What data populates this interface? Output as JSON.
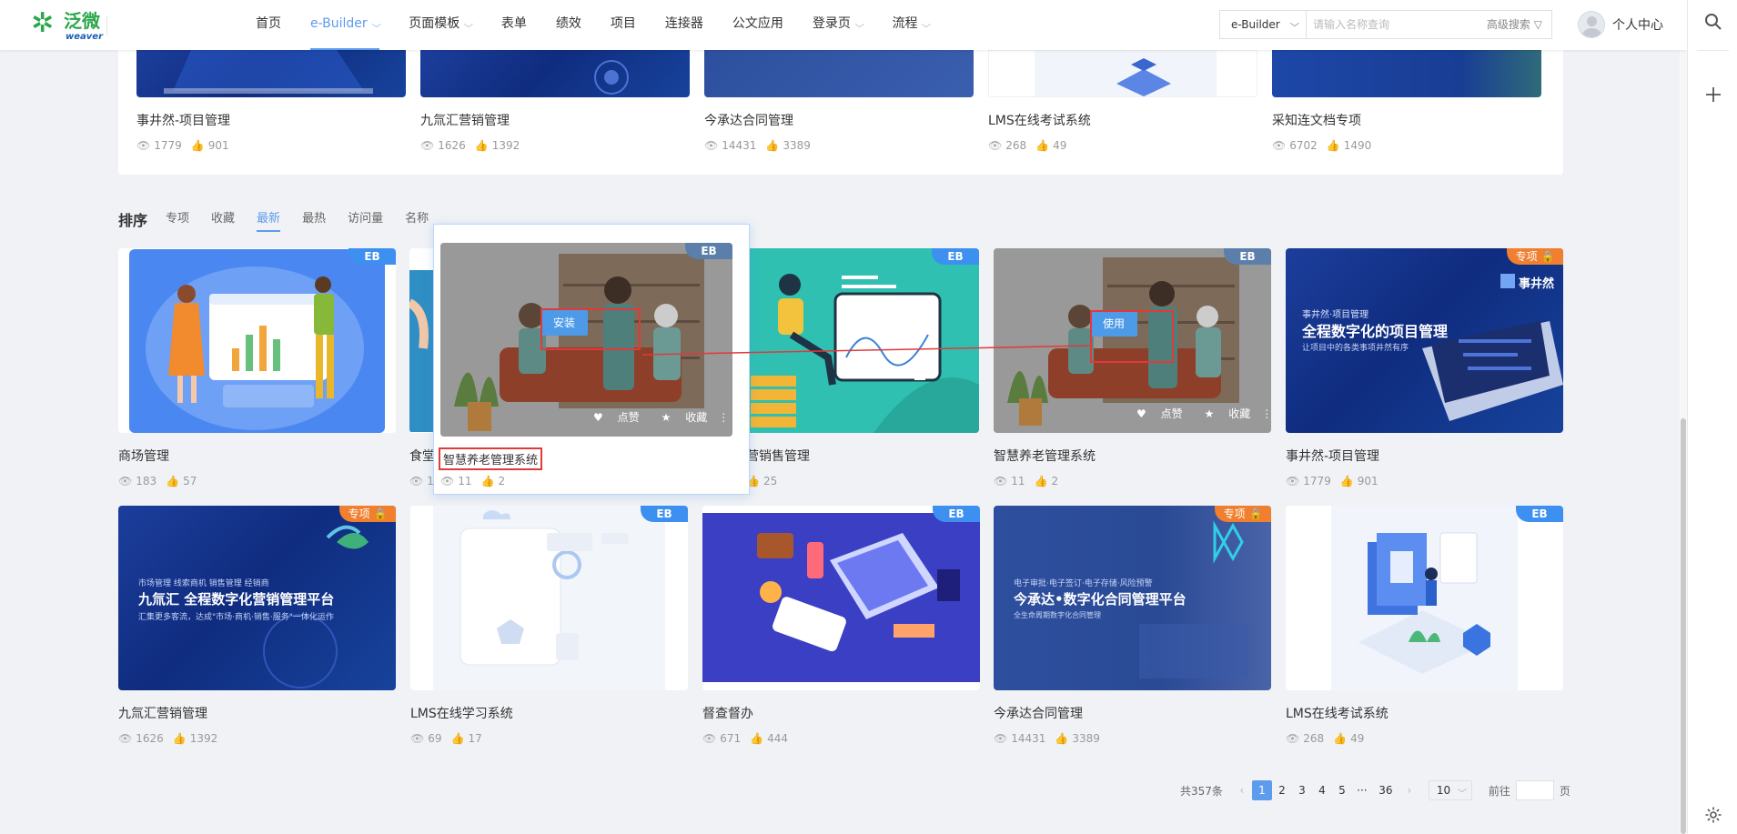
{
  "header": {
    "logo_cn": "泛微",
    "logo_en": "weaver",
    "nav": [
      {
        "label": "首页",
        "dropdown": false,
        "active": false
      },
      {
        "label": "e-Builder",
        "dropdown": true,
        "active": true
      },
      {
        "label": "页面模板",
        "dropdown": true,
        "active": false
      },
      {
        "label": "表单",
        "dropdown": false,
        "active": false
      },
      {
        "label": "绩效",
        "dropdown": false,
        "active": false
      },
      {
        "label": "项目",
        "dropdown": false,
        "active": false
      },
      {
        "label": "连接器",
        "dropdown": false,
        "active": false
      },
      {
        "label": "公文应用",
        "dropdown": false,
        "active": false
      },
      {
        "label": "登录页",
        "dropdown": true,
        "active": false
      },
      {
        "label": "流程",
        "dropdown": true,
        "active": false
      }
    ],
    "search_scope": "e-Builder",
    "search_placeholder": "请输入名称查询",
    "advanced_search": "高级搜索",
    "user_label": "个人中心"
  },
  "top_row": [
    {
      "title": "事井然-项目管理",
      "views": "1779",
      "likes": "901"
    },
    {
      "title": "九氚汇营销管理",
      "views": "1626",
      "likes": "1392"
    },
    {
      "title": "今承达合同管理",
      "views": "14431",
      "likes": "3389"
    },
    {
      "title": "LMS在线考试系统",
      "views": "268",
      "likes": "49"
    },
    {
      "title": "采知连文档专项",
      "views": "6702",
      "likes": "1490"
    }
  ],
  "sort": {
    "title": "排序",
    "tabs": [
      "专项",
      "收藏",
      "最新",
      "最热",
      "访问量",
      "名称"
    ],
    "active": "最新"
  },
  "row1": [
    {
      "title": "商场管理",
      "views": "183",
      "likes": "57",
      "badge": "EB"
    },
    {
      "title": "食堂",
      "views": "1",
      "likes": "",
      "badge": "EB"
    },
    {
      "title": "营销售管理",
      "views": "",
      "likes": "25",
      "badge": "EB"
    },
    {
      "title": "智慧养老管理系统",
      "views": "11",
      "likes": "2",
      "badge": "EB"
    },
    {
      "title": "事井然-项目管理",
      "views": "1779",
      "likes": "901",
      "badge": "专项"
    }
  ],
  "hover_card": {
    "title": "智慧养老管理系统",
    "views": "11",
    "likes": "2",
    "badge": "EB",
    "install": "安装",
    "like": "点赞",
    "favorite": "收藏"
  },
  "card4_overlay": {
    "use": "使用",
    "like": "点赞",
    "favorite": "收藏"
  },
  "row2": [
    {
      "title": "九氚汇营销管理",
      "views": "1626",
      "likes": "1392",
      "badge": "专项"
    },
    {
      "title": "LMS在线学习系统",
      "views": "69",
      "likes": "17",
      "badge": "EB"
    },
    {
      "title": "督查督办",
      "views": "671",
      "likes": "444",
      "badge": "EB"
    },
    {
      "title": "今承达合同管理",
      "views": "14431",
      "likes": "3389",
      "badge": "专项"
    },
    {
      "title": "LMS在线考试系统",
      "views": "268",
      "likes": "49",
      "badge": "EB"
    }
  ],
  "banners": {
    "sjr_brand": "事井然",
    "sjr_small": "事井然·项目管理",
    "sjr_big": "全程数字化的项目管理",
    "sjr_sub": "让项目中的各类事项井然有序",
    "jqh_small": "市场管理 线索商机 销售管理 经销商",
    "jqh_big": "九氚汇 全程数字化营销管理平台",
    "jqh_sub": "汇集更多客流，达成\"市场·商机·销售·服务\"一体化运作",
    "jcd_small": "电子审批·电子签订·电子存储·风险预警",
    "jcd_big": "今承达•数字化合同管理平台",
    "jcd_sub": "全生命周期数字化合同管理"
  },
  "pagination": {
    "total": "共357条",
    "pages": [
      "1",
      "2",
      "3",
      "4",
      "5",
      "···",
      "36"
    ],
    "current": "1",
    "page_size": "10",
    "jump_prefix": "前往",
    "jump_suffix": "页"
  },
  "colors": {
    "accent": "#5d9cec",
    "eb_badge": "#3d8ff0",
    "special_badge": "#f07f2f",
    "highlight": "#e13a3a"
  }
}
